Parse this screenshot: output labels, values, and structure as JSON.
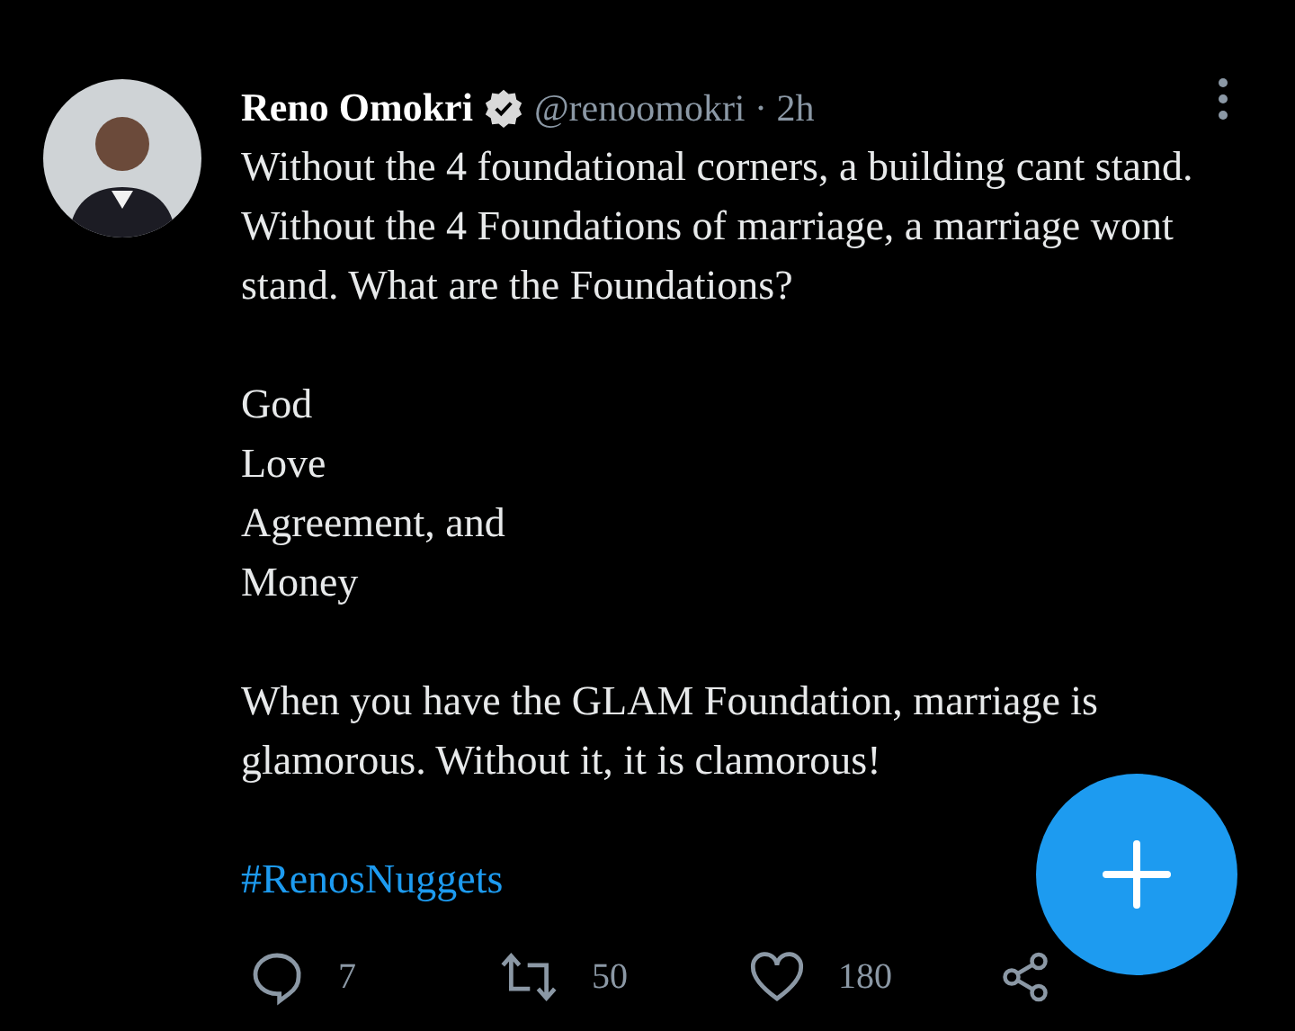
{
  "tweet": {
    "author": "Reno Omokri",
    "verified": true,
    "meta": "@renoomokri · 2h",
    "intro": "Without the 4 foundational corners, a building cant stand. Without the 4 Foundations of marriage, a marriage wont stand. What are the Foundations?",
    "list": [
      "God",
      "Love",
      "Agreement, and",
      "Money"
    ],
    "closing": "When you have the GLAM Foundation, marriage is glamorous. Without it, it is clamorous!",
    "hashtag": "#RenosNuggets",
    "actions": [
      {
        "kind": "reply",
        "count": "7"
      },
      {
        "kind": "retweet",
        "count": "50"
      },
      {
        "kind": "like",
        "count": "180"
      },
      {
        "kind": "share"
      }
    ]
  }
}
